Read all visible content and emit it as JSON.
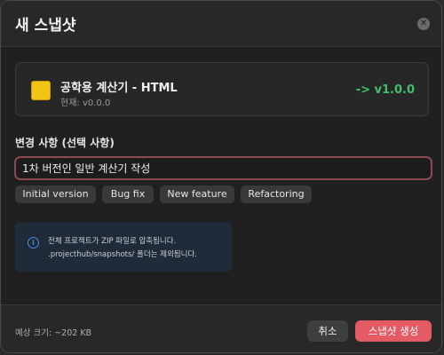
{
  "dialog": {
    "title": "새 스냅샷",
    "close_icon": "close-icon"
  },
  "version_card": {
    "project_icon": "folder-icon",
    "project_name": "공학용 계산기 - HTML",
    "current_version": "현재: v0.0.0",
    "next_version": "-> v1.0.0",
    "next_version_color": "#3ec16b"
  },
  "changes": {
    "label": "변경 사항 (선택 사항)",
    "input_value": "1차 버전인 일반 계산기 작성",
    "chips": [
      "Initial version",
      "Bug fix",
      "New feature",
      "Refactoring"
    ]
  },
  "info": {
    "icon": "info-icon",
    "line1": "전체 프로젝트가 ZIP 파일로 압축됩니다.",
    "line2": ".projecthub/snapshots/ 폴더는 제외됩니다."
  },
  "footer": {
    "size_estimate": "예상 크기: ~202 KB",
    "cancel_label": "취소",
    "create_label": "스냅샷 생성",
    "accent_color": "#e55b63"
  }
}
